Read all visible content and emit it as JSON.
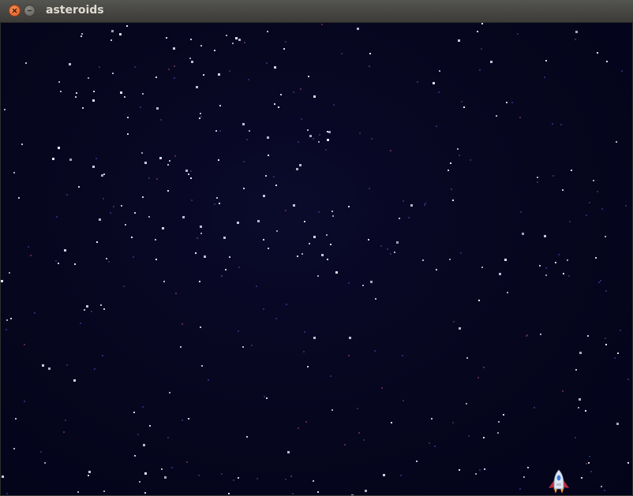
{
  "window": {
    "title": "asteroids"
  },
  "colors": {
    "space_background": "#05051f",
    "star_bright": "#e8e8ff",
    "star_dim": "#2c2a6a"
  },
  "icons": {
    "close": "close-icon",
    "minimize": "minimize-icon",
    "player": "rocket-ship-icon"
  }
}
